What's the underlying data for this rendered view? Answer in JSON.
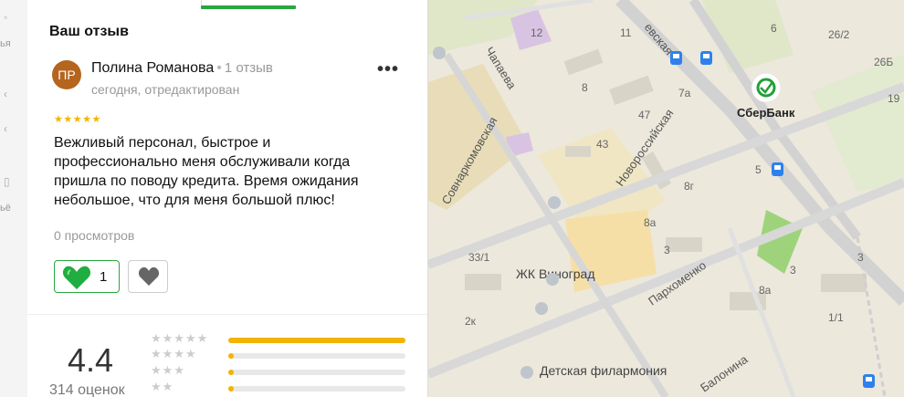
{
  "sidebar_partial": [
    "ья",
    "ьё"
  ],
  "review": {
    "section_title": "Ваш отзыв",
    "avatar_initials": "ПР",
    "author_name": "Полина Романова",
    "author_review_count": "1 отзыв",
    "meta": "сегодня, отредактирован",
    "more_icon_text": "•••",
    "rating": 5,
    "stars_text": "★★★★★",
    "text": "Вежливый персонал, быстрое и профессионально меня обслуживали когда пришла по поводу кредита. Время ожидания небольшое, что для меня большой плюс!",
    "views": "0 просмотров",
    "likes": "1"
  },
  "summary": {
    "rating_value": "4.4",
    "rating_count": "314 оценок",
    "distribution": [
      {
        "stars": "★★★★★",
        "fraction": 1.0
      },
      {
        "stars": "★★★★",
        "fraction": 0.03
      },
      {
        "stars": "★★★",
        "fraction": 0.03
      },
      {
        "stars": "★★",
        "fraction": 0.03
      }
    ]
  },
  "map": {
    "streets": [
      "евская",
      "Чапаева",
      "Совнаркомовская",
      "Новороссийская",
      "Пархоменко",
      "Балонина"
    ],
    "places": [
      "СберБанк",
      "ЖК Виноград",
      "Детская филармония"
    ],
    "house_numbers": [
      "12",
      "11",
      "6",
      "26/2",
      "26Б",
      "8",
      "7а",
      "47",
      "43",
      "5",
      "8г",
      "8а",
      "3",
      "3",
      "33/1",
      "2к",
      "1/1",
      "8а",
      "3",
      "19"
    ],
    "colors": {
      "sber_green": "#21a038",
      "bus_stop_blue": "#2f80ed",
      "road": "#d2d2d2"
    }
  },
  "colors": {
    "accent_green": "#2aa642",
    "star_yellow": "#f3b400",
    "avatar_bg": "#b5651d"
  }
}
